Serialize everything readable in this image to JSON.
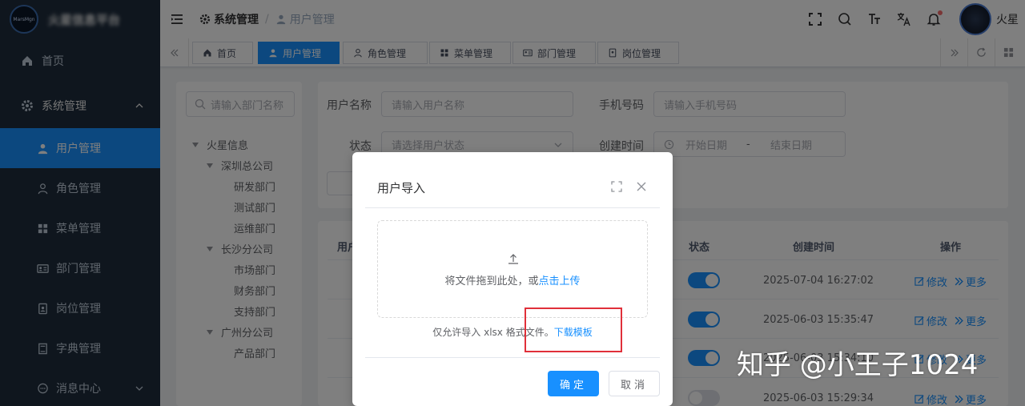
{
  "sidebar": {
    "logo_text": "MarsMgn",
    "title": "火星信息平台",
    "items": [
      {
        "label": "首页"
      },
      {
        "label": "系统管理"
      },
      {
        "label": "用户管理"
      },
      {
        "label": "角色管理"
      },
      {
        "label": "菜单管理"
      },
      {
        "label": "部门管理"
      },
      {
        "label": "岗位管理"
      },
      {
        "label": "字典管理"
      },
      {
        "label": "消息中心"
      }
    ]
  },
  "header": {
    "breadcrumb": [
      "系统管理",
      "用户管理"
    ],
    "separator": "/",
    "username": "火星"
  },
  "tags": [
    {
      "label": "首页"
    },
    {
      "label": "用户管理"
    },
    {
      "label": "角色管理"
    },
    {
      "label": "菜单管理"
    },
    {
      "label": "部门管理"
    },
    {
      "label": "岗位管理"
    }
  ],
  "tree": {
    "search_placeholder": "请输入部门名称",
    "nodes": [
      "火星信息",
      "深圳总公司",
      "研发部门",
      "测试部门",
      "运维部门",
      "长沙分公司",
      "市场部门",
      "财务部门",
      "支持部门",
      "广州分公司",
      "产品部门"
    ]
  },
  "filters": {
    "username_label": "用户名称",
    "username_placeholder": "请输入用户名称",
    "phone_label": "手机号码",
    "phone_placeholder": "请输入手机号码",
    "status_label": "状态",
    "status_placeholder": "请选择用户状态",
    "created_label": "创建时间",
    "start_placeholder": "开始日期",
    "date_sep": "-",
    "end_placeholder": "结束日期"
  },
  "table": {
    "col_user": "用户",
    "col_status": "状态",
    "col_created": "创建时间",
    "col_ops": "操作",
    "edit_label": "修改",
    "more_label": "更多",
    "rows": [
      {
        "created": "2025-07-04 16:27:02",
        "status_on": true
      },
      {
        "created": "2025-06-03 15:35:47",
        "status_on": true
      },
      {
        "created": "2025-06-03 15:34:10",
        "status_on": true
      },
      {
        "created": "2025-06-03 15:29:34",
        "status_on": false
      }
    ]
  },
  "dialog": {
    "title": "用户导入",
    "upload_text": "将文件拖到此处，或",
    "upload_link": "点击上传",
    "tip_text": "仅允许导入 xlsx 格式文件。",
    "tip_link": "下载模板",
    "ok_label": "确定",
    "cancel_label": "取消"
  },
  "watermark": "知乎 @小王子1024"
}
